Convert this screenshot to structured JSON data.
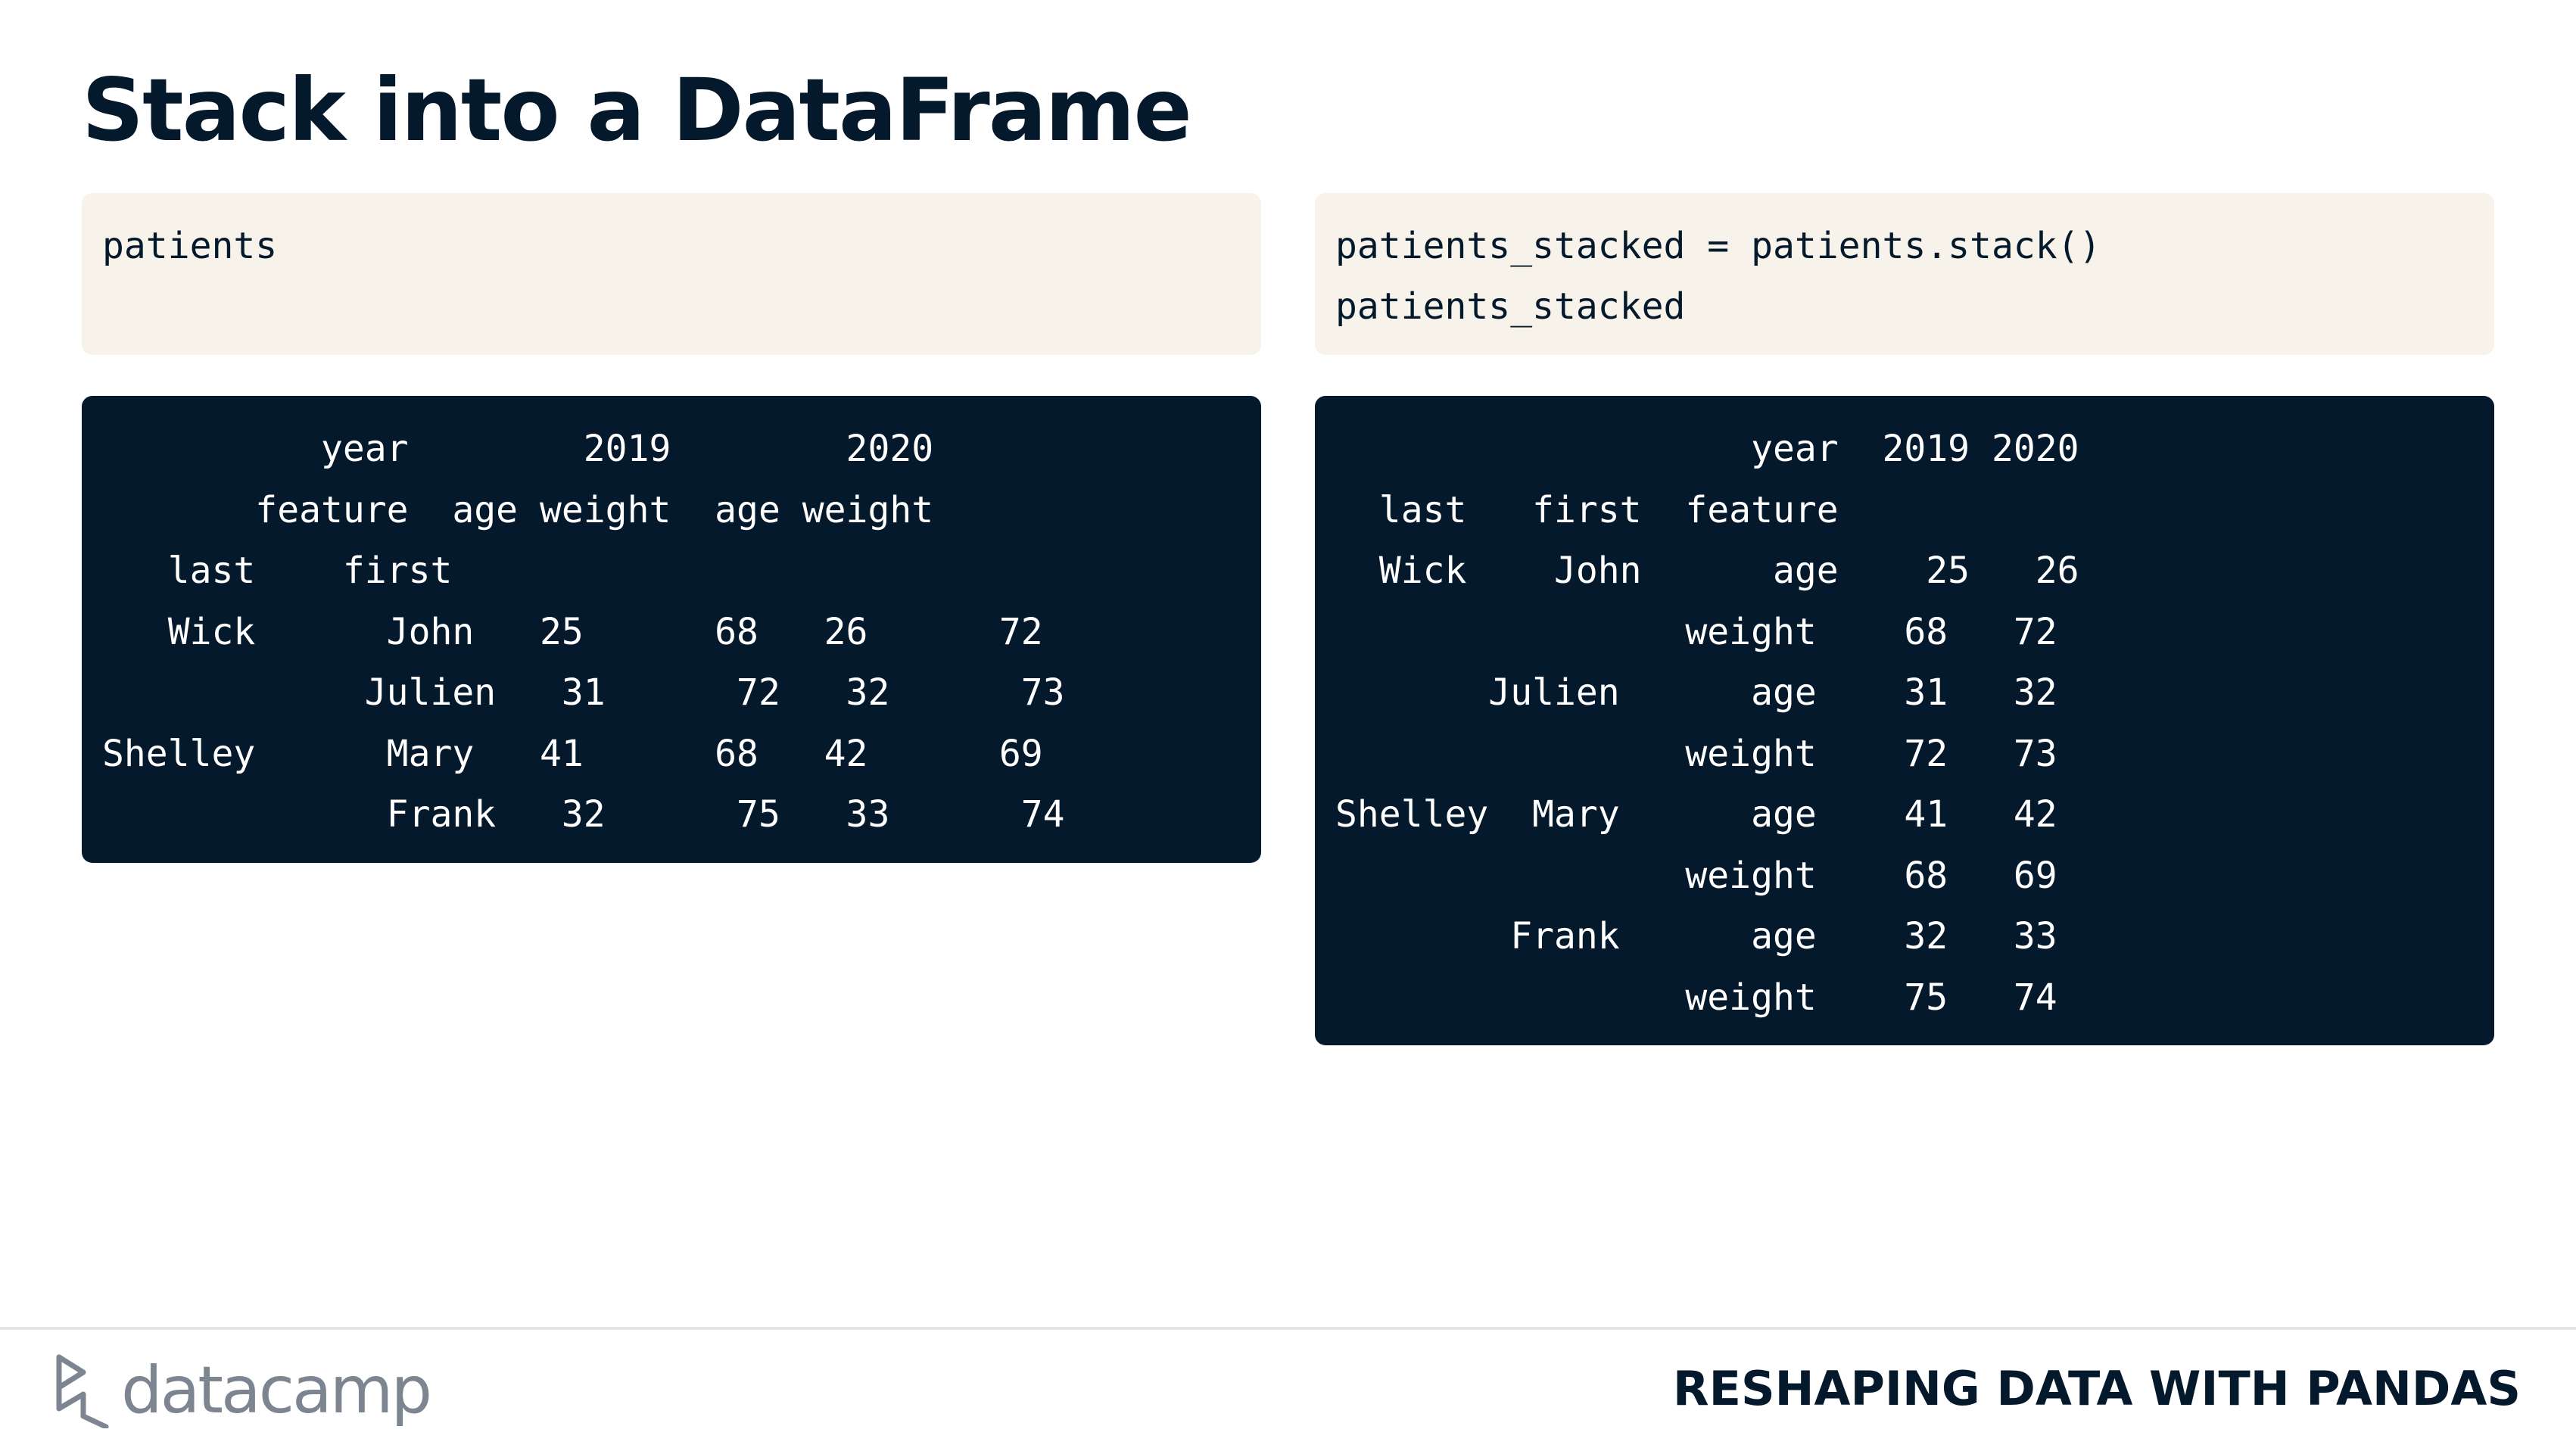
{
  "title": "Stack into a DataFrame",
  "left": {
    "code": [
      "patients"
    ],
    "output": [
      "          year        2019        2020",
      "       feature  age weight  age weight",
      "   last    first",
      "   Wick      John   25      68   26      72",
      "            Julien   31      72   32      73",
      "Shelley      Mary   41      68   42      69",
      "             Frank   32      75   33      74"
    ]
  },
  "right": {
    "code": [
      "patients_stacked = patients.stack()",
      "patients_stacked"
    ],
    "output": [
      "                   year  2019 2020",
      "  last   first  feature",
      "  Wick    John      age    25   26",
      "                weight    68   72",
      "       Julien      age    31   32",
      "                weight    72   73",
      "Shelley  Mary      age    41   42",
      "                weight    68   69",
      "        Frank      age    32   33",
      "                weight    75   74"
    ]
  },
  "footer": {
    "logo_text": "datacamp",
    "course": "RESHAPING DATA WITH PANDAS"
  }
}
